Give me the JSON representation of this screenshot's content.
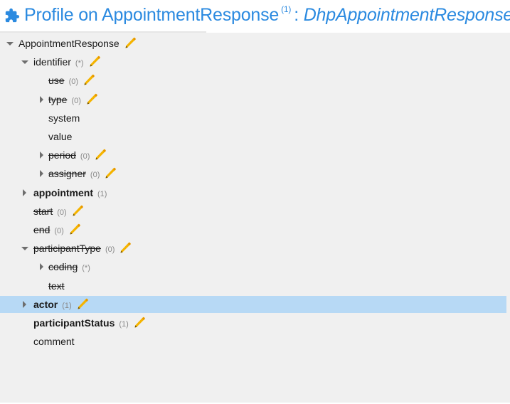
{
  "header": {
    "title": "Profile on AppointmentResponse",
    "footnote": "(1)",
    "colon": ":",
    "type_name": "DhpAppointmentResponse"
  },
  "tree": [
    {
      "name": "AppointmentResponse",
      "card": "",
      "indent": 0,
      "toggle": "down",
      "strike": false,
      "bold": false,
      "pen": true,
      "selected": false
    },
    {
      "name": "identifier",
      "card": "(*)",
      "indent": 1,
      "toggle": "down",
      "strike": false,
      "bold": false,
      "pen": true,
      "selected": false
    },
    {
      "name": "use",
      "card": "(0)",
      "indent": 2,
      "toggle": "none",
      "strike": true,
      "bold": false,
      "pen": true,
      "selected": false
    },
    {
      "name": "type",
      "card": "(0)",
      "indent": 2,
      "toggle": "right",
      "strike": true,
      "bold": false,
      "pen": true,
      "selected": false
    },
    {
      "name": "system",
      "card": "",
      "indent": 2,
      "toggle": "none",
      "strike": false,
      "bold": false,
      "pen": false,
      "selected": false
    },
    {
      "name": "value",
      "card": "",
      "indent": 2,
      "toggle": "none",
      "strike": false,
      "bold": false,
      "pen": false,
      "selected": false
    },
    {
      "name": "period",
      "card": "(0)",
      "indent": 2,
      "toggle": "right",
      "strike": true,
      "bold": false,
      "pen": true,
      "selected": false
    },
    {
      "name": "assigner",
      "card": "(0)",
      "indent": 2,
      "toggle": "right",
      "strike": true,
      "bold": false,
      "pen": true,
      "selected": false
    },
    {
      "name": "appointment",
      "card": "(1)",
      "indent": 1,
      "toggle": "right",
      "strike": false,
      "bold": true,
      "pen": false,
      "selected": false
    },
    {
      "name": "start",
      "card": "(0)",
      "indent": 1,
      "toggle": "none",
      "strike": true,
      "bold": false,
      "pen": true,
      "selected": false
    },
    {
      "name": "end",
      "card": "(0)",
      "indent": 1,
      "toggle": "none",
      "strike": true,
      "bold": false,
      "pen": true,
      "selected": false
    },
    {
      "name": "participantType",
      "card": "(0)",
      "indent": 1,
      "toggle": "down",
      "strike": true,
      "bold": false,
      "pen": true,
      "selected": false
    },
    {
      "name": "coding",
      "card": "(*)",
      "indent": 2,
      "toggle": "right",
      "strike": true,
      "bold": false,
      "pen": false,
      "selected": false
    },
    {
      "name": "text",
      "card": "",
      "indent": 2,
      "toggle": "none",
      "strike": true,
      "bold": false,
      "pen": false,
      "selected": false
    },
    {
      "name": "actor",
      "card": "(1)",
      "indent": 1,
      "toggle": "right",
      "strike": false,
      "bold": true,
      "pen": true,
      "selected": true
    },
    {
      "name": "participantStatus",
      "card": "(1)",
      "indent": 1,
      "toggle": "none",
      "strike": false,
      "bold": true,
      "pen": true,
      "selected": false
    },
    {
      "name": "comment",
      "card": "",
      "indent": 1,
      "toggle": "none",
      "strike": false,
      "bold": false,
      "pen": false,
      "selected": false
    }
  ],
  "icons": {
    "header_icon": "puzzle-icon",
    "edit_icon": "pen-icon"
  },
  "colors": {
    "title": "#2b8ae0",
    "selection": "#b7d9f5",
    "pen": "#f5b400"
  }
}
